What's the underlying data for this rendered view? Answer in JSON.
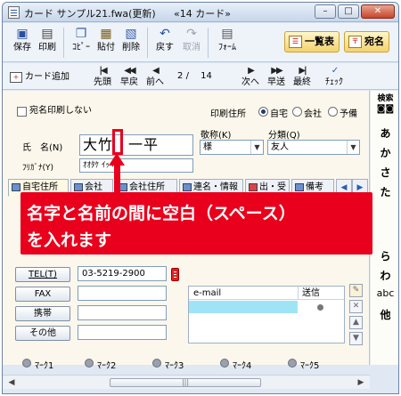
{
  "window": {
    "title": "カード サンプル21.fwa(更新)",
    "subtitle": "«14 カード»",
    "minimize": "–",
    "maximize": "□",
    "close": "✕"
  },
  "toolbar": {
    "items": [
      {
        "label": "保存",
        "icon": "save-icon",
        "glyph": "💾"
      },
      {
        "label": "印刷",
        "icon": "print-icon",
        "glyph": "🖨"
      },
      {
        "label": "ｺﾋﾟｰ",
        "icon": "copy-icon",
        "glyph": "📄"
      },
      {
        "label": "貼付",
        "icon": "paste-icon",
        "glyph": "📋"
      },
      {
        "label": "削除",
        "icon": "delete-icon",
        "glyph": "🗑"
      },
      {
        "label": "戻す",
        "icon": "undo-icon",
        "glyph": "↶"
      },
      {
        "label": "取消",
        "icon": "cancel-icon",
        "glyph": "↷"
      },
      {
        "label": "ﾌｫｰﾑ",
        "icon": "form-icon",
        "glyph": "▤"
      }
    ],
    "list_button": "一覧表",
    "address_button": "宛名"
  },
  "navbar": {
    "add_card": "カード追加",
    "first": "先頭",
    "prev_page": "早戻",
    "prev": "前へ",
    "page_current": "2",
    "page_sep": "/",
    "page_total": "14",
    "next": "次へ",
    "next_page": "早送",
    "last": "最終",
    "check": "ﾁｪｯｸ"
  },
  "form": {
    "no_print_label": "宛名印刷しない",
    "print_address_label": "印刷住所",
    "address_options": [
      "自宅",
      "会社",
      "予備"
    ],
    "selected_address": "自宅",
    "name_label": "氏　名(N)",
    "name_value": "大竹　一平",
    "furigana_label": "ﾌﾘｶﾞﾅ(Y)",
    "furigana_value": "ｵｵﾀｹ ｲｯﾍﾟｲ",
    "honorific_label": "敬称(K)",
    "honorific_value": "様",
    "category_label": "分類(Q)",
    "category_value": "友人"
  },
  "tabs": [
    "自宅住所",
    "会社",
    "会社住所",
    "連名・情報",
    "出・受",
    "備考"
  ],
  "callout": {
    "line1": "名字と名前の間に空白（スペース）",
    "line2": "を入れます"
  },
  "contacts": {
    "tel_label": "TEL(T)",
    "tel_value": "03-5219-2900",
    "fax_label": "FAX",
    "mobile_label": "携帯",
    "other_label": "その他"
  },
  "email": {
    "col_email": "e-mail",
    "col_send": "送信"
  },
  "marks": [
    "ﾏｰｸ1",
    "ﾏｰｸ2",
    "ﾏｰｸ3",
    "ﾏｰｸ4",
    "ﾏｰｸ5"
  ],
  "sidebar": {
    "search_label": "検索",
    "kana": [
      "あ",
      "か",
      "さ",
      "た",
      "ら",
      "わ",
      "abc",
      "他"
    ]
  },
  "scrollbar": {
    "grip": "|||"
  }
}
